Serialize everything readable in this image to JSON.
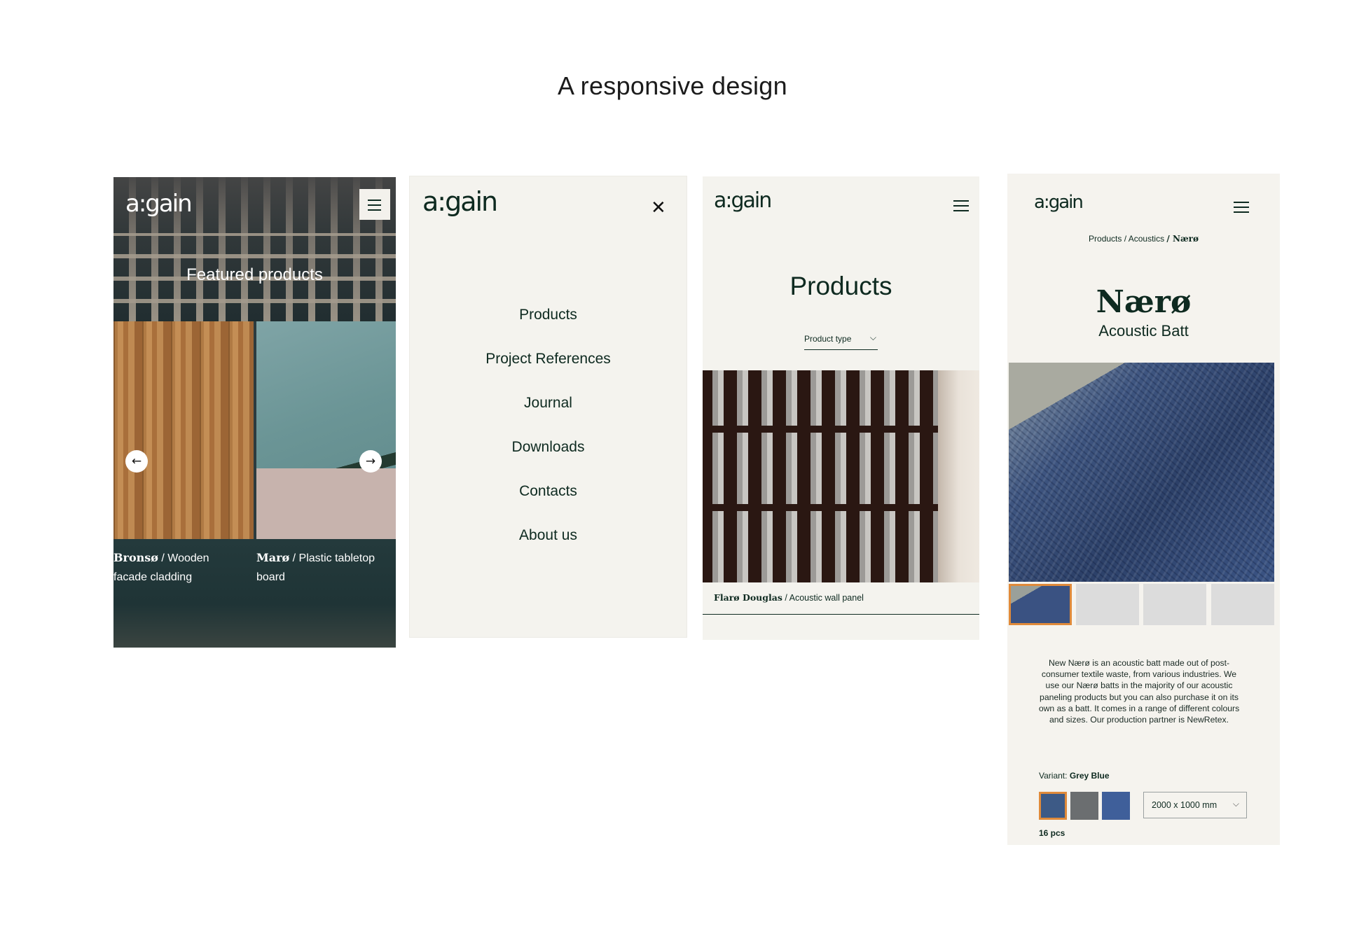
{
  "heading": "A responsive design",
  "brand": {
    "logo_text": "a:gain",
    "accent_color": "#e08a3a",
    "dark_green": "#0e2a20",
    "panel_bg": "#f4f3ee"
  },
  "screen_home": {
    "hero_title": "Featured products",
    "menu_icon": "hamburger-icon",
    "prev_icon": "arrow-left-icon",
    "next_icon": "arrow-right-icon",
    "cards": [
      {
        "name": "Bronsø",
        "description": " / Wooden facade cladding"
      },
      {
        "name": "Marø",
        "description": " / Plastic tabletop board"
      }
    ]
  },
  "screen_menu": {
    "close_icon": "close-icon",
    "items": [
      {
        "label": "Products"
      },
      {
        "label": "Project References"
      },
      {
        "label": "Journal"
      },
      {
        "label": "Downloads"
      },
      {
        "label": "Contacts"
      },
      {
        "label": "About us"
      }
    ]
  },
  "screen_products": {
    "title": "Products",
    "filter_label": "Product type",
    "product_name": "Flarø Douglas",
    "product_type": " / Acoustic wall panel"
  },
  "screen_detail": {
    "breadcrumbs": {
      "level1": "Products",
      "level2": "/ Acoustics",
      "current": "/ Nærø"
    },
    "product_name": "Nærø",
    "product_type": "Acoustic Batt",
    "description": "New Nærø is an acoustic batt made out of post-consumer textile waste, from various industries. We use our Nærø batts in the majority of our acoustic paneling products but you can also purchase it on its own as a batt. It comes in a range of different colours and sizes. Our production partner is NewRetex.",
    "variant_label": "Variant: ",
    "variant_value": "Grey Blue",
    "swatches": [
      {
        "color": "#3d5a86",
        "selected": true
      },
      {
        "color": "#6b6e70",
        "selected": false
      },
      {
        "color": "#3f5f9a",
        "selected": false
      }
    ],
    "size_value": "2000 x 1000 mm",
    "quantity": "16 pcs"
  }
}
